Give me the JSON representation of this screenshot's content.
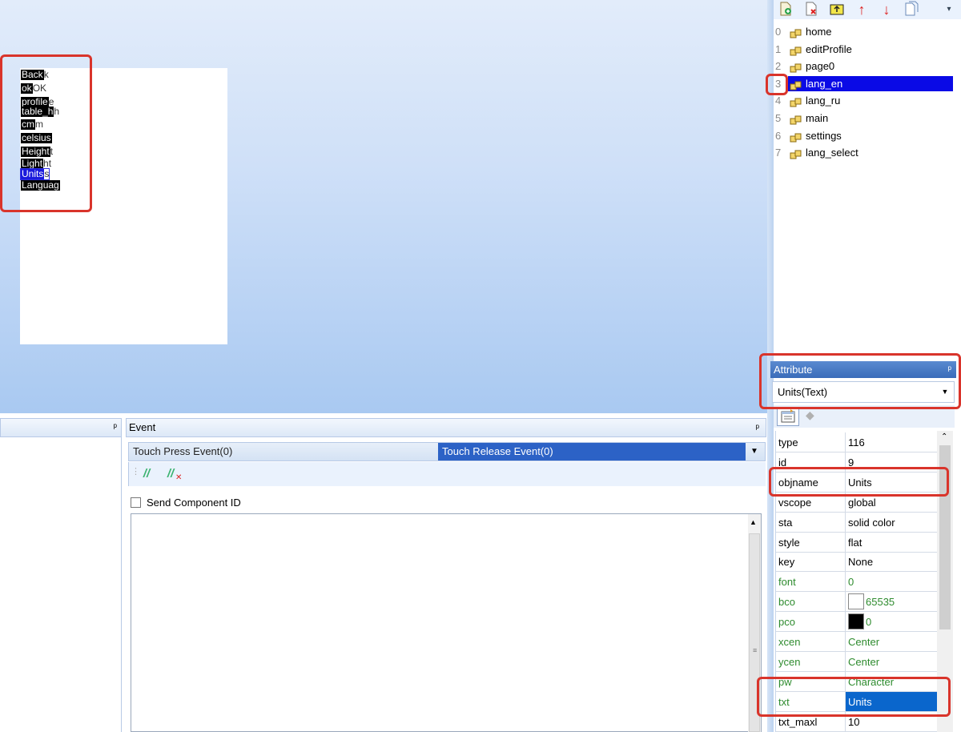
{
  "canvas": {
    "components": [
      {
        "label": "Back",
        "ghost": "k",
        "selected": false
      },
      {
        "label": "ok",
        "ghost": "OK",
        "selected": false
      },
      {
        "label": "profile",
        "ghost": "e",
        "selected": false
      },
      {
        "label": "table_h",
        "ghost": "h",
        "selected": false
      },
      {
        "label": "cm",
        "ghost": "m",
        "selected": false
      },
      {
        "label": "celsius",
        "ghost": "",
        "selected": false
      },
      {
        "label": "Height",
        "ghost": "t",
        "selected": false
      },
      {
        "label": "Light",
        "ghost": "ht",
        "selected": false
      },
      {
        "label": "Units",
        "ghost": "s",
        "selected": true
      },
      {
        "label": "Languag",
        "ghost": "",
        "selected": false
      }
    ]
  },
  "page_list": {
    "toolbar_icons": [
      "add-page-icon",
      "delete-page-icon",
      "insert-page-icon",
      "move-up-icon",
      "move-down-icon",
      "copy-page-icon"
    ],
    "pages": [
      {
        "index": "0",
        "name": "home"
      },
      {
        "index": "1",
        "name": "editProfile"
      },
      {
        "index": "2",
        "name": "page0"
      },
      {
        "index": "3",
        "name": "lang_en"
      },
      {
        "index": "4",
        "name": "lang_ru"
      },
      {
        "index": "5",
        "name": "main"
      },
      {
        "index": "6",
        "name": "settings"
      },
      {
        "index": "7",
        "name": "lang_select"
      }
    ],
    "selected_index": 3
  },
  "attribute": {
    "title": "Attribute",
    "pin": "ᵖ",
    "selected_object": "Units(Text)",
    "rows": [
      {
        "key": "type",
        "value": "116",
        "green": false
      },
      {
        "key": "id",
        "value": "9",
        "green": false
      },
      {
        "key": "objname",
        "value": "Units",
        "green": false
      },
      {
        "key": "vscope",
        "value": "global",
        "green": false
      },
      {
        "key": "sta",
        "value": "solid color",
        "green": false
      },
      {
        "key": "style",
        "value": "flat",
        "green": false
      },
      {
        "key": "key",
        "value": "None",
        "green": false
      },
      {
        "key": "font",
        "value": "0",
        "green": true
      },
      {
        "key": "bco",
        "value": "65535",
        "green": true,
        "swatch": "#ffffff"
      },
      {
        "key": "pco",
        "value": "0",
        "green": true,
        "swatch": "#000000"
      },
      {
        "key": "xcen",
        "value": "Center",
        "green": true
      },
      {
        "key": "ycen",
        "value": "Center",
        "green": true
      },
      {
        "key": "pw",
        "value": "Character",
        "green": true
      },
      {
        "key": "txt",
        "value": "Units",
        "green": true,
        "selected": true
      },
      {
        "key": "txt_maxl",
        "value": "10",
        "green": false
      }
    ]
  },
  "bottom_left": {
    "pin": "ᵖ"
  },
  "event": {
    "title": "Event",
    "pin": "ᵖ",
    "tabs": [
      "Touch Press Event(0)",
      "Touch Release Event(0)"
    ],
    "active_tab": 1,
    "send_component_id": "Send Component ID",
    "send_component_id_checked": false
  },
  "colors": {
    "selection_blue": "#0a0ae6",
    "highlight_red": "#d9342b",
    "attr_green": "#2e8b2e"
  }
}
